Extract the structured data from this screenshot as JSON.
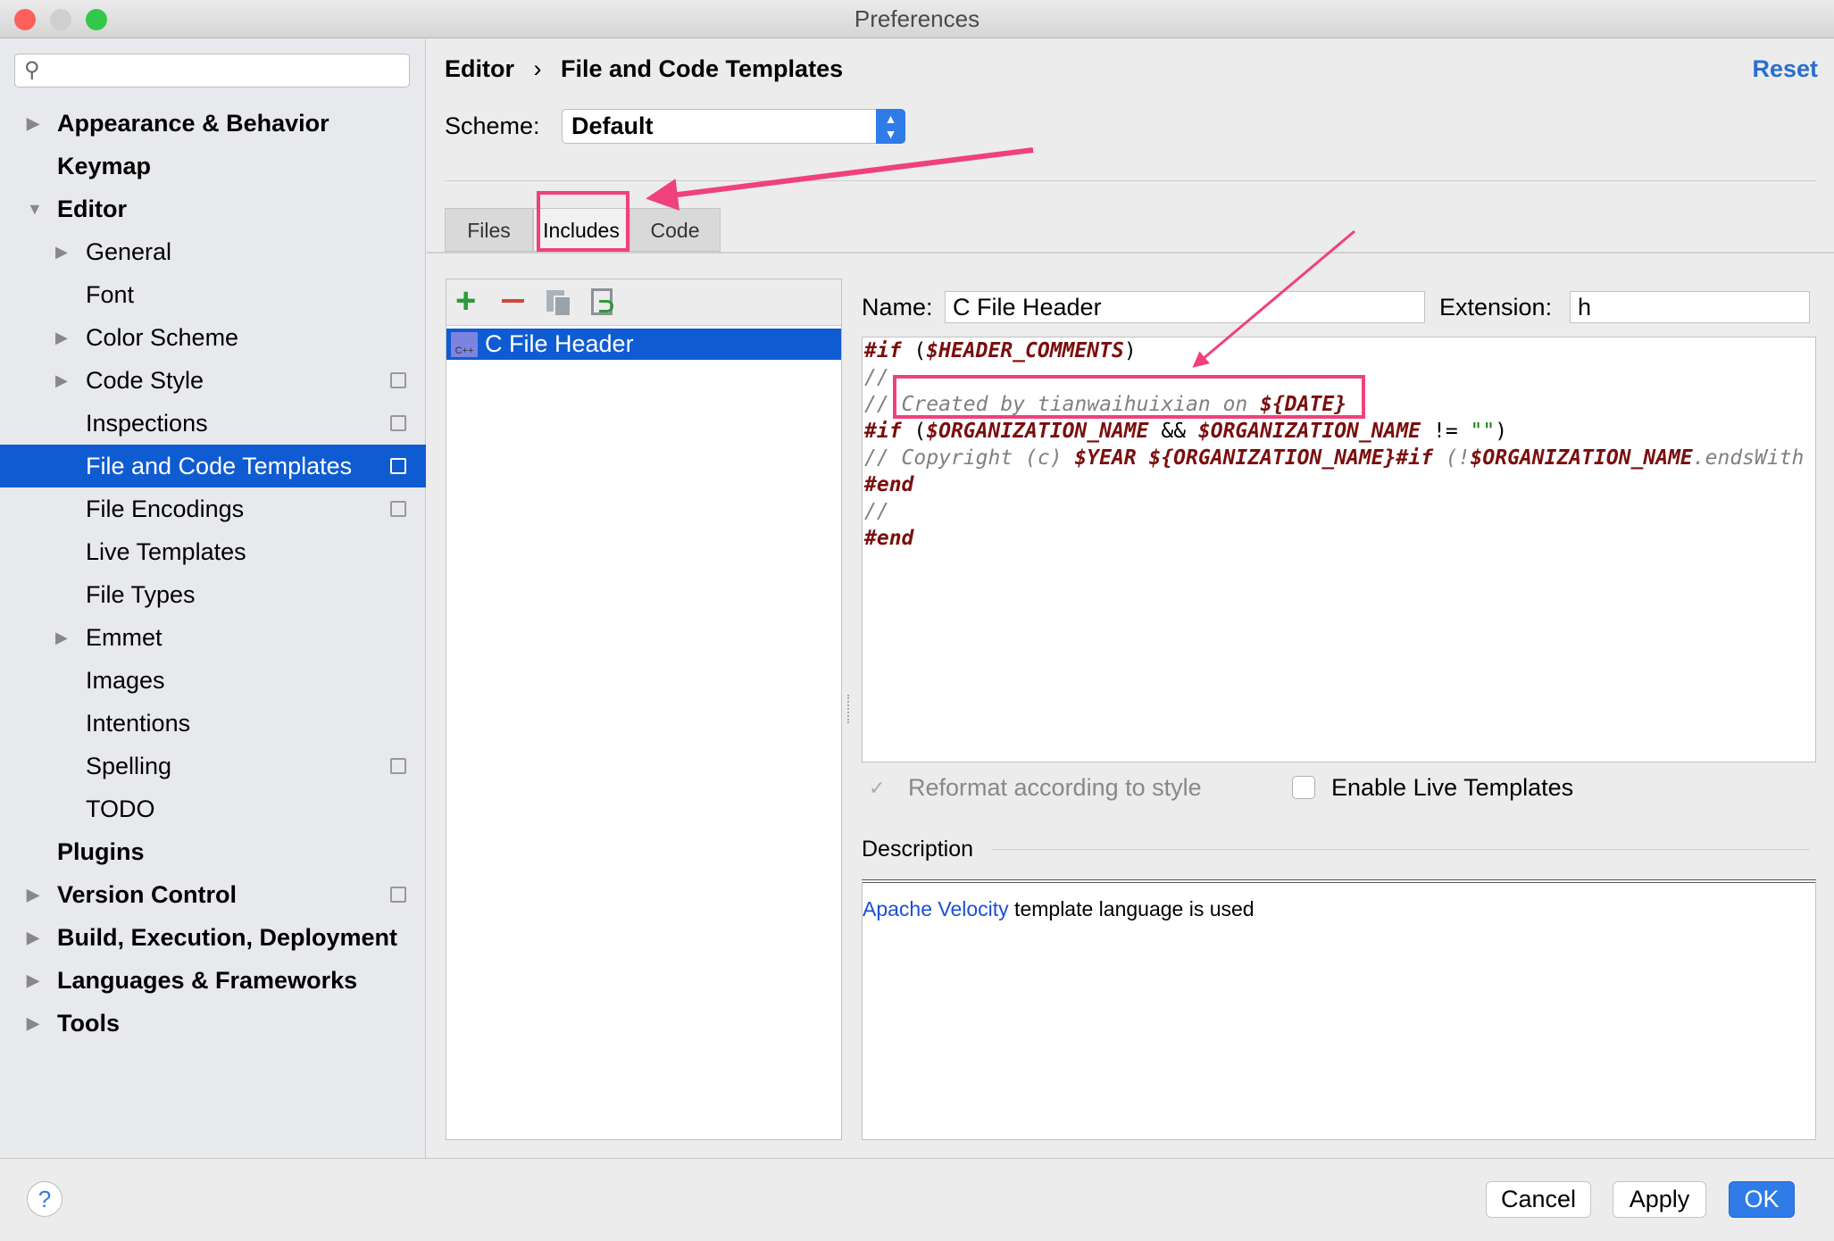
{
  "window": {
    "title": "Preferences"
  },
  "sidebar": {
    "search_placeholder": "",
    "items": [
      {
        "label": "Appearance & Behavior"
      },
      {
        "label": "Keymap"
      },
      {
        "label": "Editor"
      },
      {
        "label": "General"
      },
      {
        "label": "Font"
      },
      {
        "label": "Color Scheme"
      },
      {
        "label": "Code Style"
      },
      {
        "label": "Inspections"
      },
      {
        "label": "File and Code Templates"
      },
      {
        "label": "File Encodings"
      },
      {
        "label": "Live Templates"
      },
      {
        "label": "File Types"
      },
      {
        "label": "Emmet"
      },
      {
        "label": "Images"
      },
      {
        "label": "Intentions"
      },
      {
        "label": "Spelling"
      },
      {
        "label": "TODO"
      },
      {
        "label": "Plugins"
      },
      {
        "label": "Version Control"
      },
      {
        "label": "Build, Execution, Deployment"
      },
      {
        "label": "Languages & Frameworks"
      },
      {
        "label": "Tools"
      }
    ]
  },
  "header": {
    "breadcrumb_root": "Editor",
    "breadcrumb_sep": "›",
    "breadcrumb_page": "File and Code Templates",
    "reset": "Reset"
  },
  "scheme": {
    "label": "Scheme:",
    "value": "Default"
  },
  "tabs": [
    {
      "label": "Files"
    },
    {
      "label": "Includes"
    },
    {
      "label": "Code"
    }
  ],
  "templates": {
    "items": [
      {
        "label": "C File Header",
        "icon_text": "C++"
      }
    ]
  },
  "form": {
    "name_label": "Name:",
    "name_value": "C File Header",
    "extension_label": "Extension:",
    "extension_value": "h"
  },
  "code": {
    "l1a": "#if",
    "l1b": " (",
    "l1c": "$HEADER_COMMENTS",
    "l1d": ")",
    "l2": "//",
    "l3a": "// Created by tianwaihuixian on ",
    "l3b": "${DATE}",
    "l4a": "#if",
    "l4b": " (",
    "l4c": "$ORGANIZATION_NAME",
    "l4d": " && ",
    "l4e": "$ORGANIZATION_NAME",
    "l4f": " != ",
    "l4g": "\"\"",
    "l4h": ")",
    "l5a": "// Copyright (c) ",
    "l5b": "$YEAR ${ORGANIZATION_NAME}#if",
    "l5c": " (!",
    "l5d": "$ORGANIZATION_NAME",
    "l5e": ".endsWith",
    "l6": "#end",
    "l7": "//",
    "l8": "#end"
  },
  "options": {
    "reformat_label": "Reformat according to style",
    "reformat_checked": true,
    "live_label": "Enable Live Templates",
    "live_checked": false
  },
  "description": {
    "label": "Description",
    "link": "Apache Velocity",
    "text": " template language is used"
  },
  "footer": {
    "help": "?",
    "cancel": "Cancel",
    "apply": "Apply",
    "ok": "OK"
  },
  "colors": {
    "accent": "#0f5bd2",
    "annotation": "#f0417b"
  }
}
